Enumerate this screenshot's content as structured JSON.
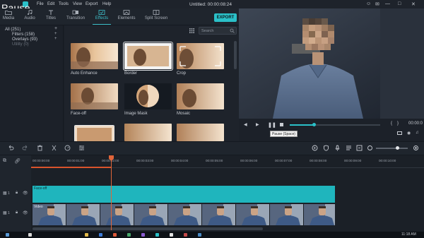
{
  "overlay_text": "Pause",
  "menu": [
    "File",
    "Edit",
    "Tools",
    "View",
    "Export",
    "Help"
  ],
  "document_title": "Untitled: 00:00:08:24",
  "toolbar": {
    "tabs": [
      {
        "label": "Media",
        "icon": "folder-icon"
      },
      {
        "label": "Audio",
        "icon": "music-note-icon"
      },
      {
        "label": "Titles",
        "icon": "text-icon"
      },
      {
        "label": "Transition",
        "icon": "transition-icon"
      },
      {
        "label": "Effects",
        "icon": "effects-icon",
        "active": true
      },
      {
        "label": "Elements",
        "icon": "elements-icon"
      },
      {
        "label": "Split Screen",
        "icon": "split-screen-icon"
      }
    ],
    "export_label": "EXPORT",
    "accent_color": "#2bc0c8"
  },
  "categories": [
    {
      "label": "All (251)"
    },
    {
      "label": "Filters (158)"
    },
    {
      "label": "Overlays (93)"
    },
    {
      "label": "Utility (0)",
      "dim": true
    }
  ],
  "search": {
    "placeholder": "Search"
  },
  "effects": [
    {
      "label": "Auto Enhance"
    },
    {
      "label": "Border",
      "selected": true
    },
    {
      "label": "Crop"
    },
    {
      "label": "Face-off"
    },
    {
      "label": "Image Mask"
    },
    {
      "label": "Mosaic"
    },
    {
      "label": ""
    },
    {
      "label": ""
    },
    {
      "label": ""
    }
  ],
  "preview": {
    "time": "00:00:0",
    "progress": 0.27,
    "tooltip": "Pause (Space)"
  },
  "timeline": {
    "ruler_labels": [
      "00:00:00:00",
      "00:00:01:00",
      "00:00:02:00",
      "00:00:03:00",
      "00:00:04:00",
      "00:00:05:00",
      "00:00:06:00",
      "00:00:07:00",
      "00:00:08:00",
      "00:00:09:00",
      "00:00:10:00"
    ],
    "track_effect_label": "Face-off",
    "track_video_label": "Video",
    "track1_label": "1",
    "track2_label": "1"
  },
  "clock": "11:18 AM"
}
